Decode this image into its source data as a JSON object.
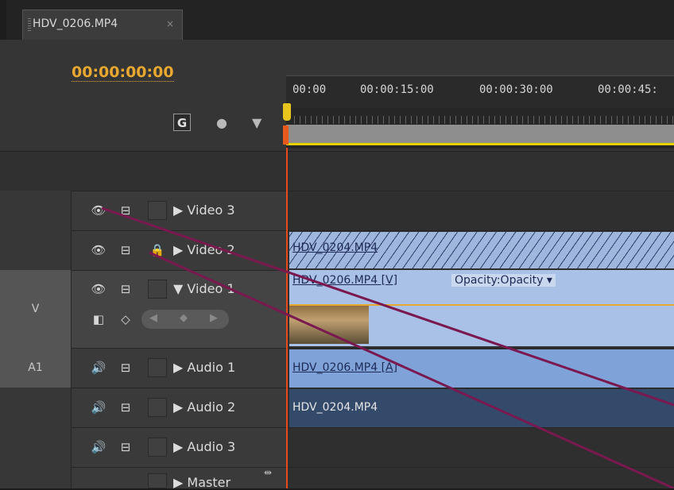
{
  "tab": {
    "title": "HDV_0206.MP4",
    "close_glyph": "×"
  },
  "header": {
    "timecode": "00:00:00:00"
  },
  "ruler": {
    "labels": [
      "00:00",
      "00:00:15:00",
      "00:00:30:00",
      "00:00:45:"
    ]
  },
  "tracks": {
    "video3": {
      "name": "Video 3",
      "arrow": "▶"
    },
    "video2": {
      "name": "Video 2",
      "arrow": "▶"
    },
    "video1": {
      "id": "V",
      "name": "Video 1",
      "arrow": "▼"
    },
    "audio1": {
      "id": "A1",
      "name": "Audio 1",
      "arrow": "▶"
    },
    "audio2": {
      "name": "Audio 2",
      "arrow": "▶"
    },
    "audio3": {
      "name": "Audio 3",
      "arrow": "▶"
    },
    "master": {
      "name": "Master",
      "arrow": "▶"
    }
  },
  "clips": {
    "video2": "HDV_0204.MP4",
    "video1": "HDV_0206.MP4 [V]",
    "video1_effect": "Opacity:Opacity ▾",
    "audio1": "HDV_0206.MP4 [A]",
    "audio2": "HDV_0204.MP4"
  },
  "colors": {
    "timecode": "#e8a830",
    "playhead": "#e84a1c",
    "workarea": "#e7d300",
    "annotation_line": "#7a1850"
  }
}
